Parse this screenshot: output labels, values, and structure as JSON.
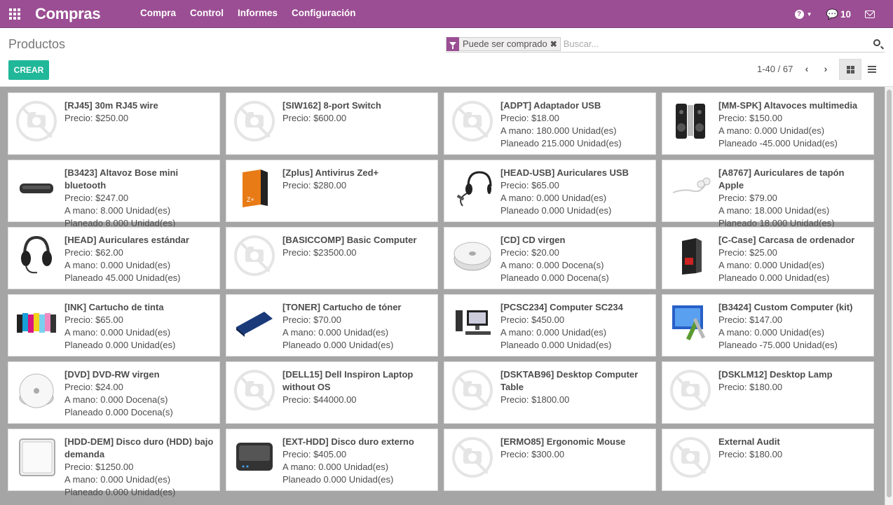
{
  "app": {
    "title": "Compras"
  },
  "menu": [
    "Compra",
    "Control",
    "Informes",
    "Configuración"
  ],
  "navbar": {
    "help_icon": "?",
    "messages_count": "10"
  },
  "control": {
    "page_title": "Productos",
    "create_label": "CREAR",
    "search_facet": "Puede ser comprado",
    "search_placeholder": "Buscar...",
    "pager": "1-40 / 67"
  },
  "products": [
    {
      "title": "[RJ45] 30m RJ45 wire",
      "lines": [
        "Precio: $250.00"
      ],
      "icon": "placeholder-icon"
    },
    {
      "title": "[SIW162] 8-port Switch",
      "lines": [
        "Precio: $600.00"
      ],
      "icon": "placeholder-icon"
    },
    {
      "title": "[ADPT] Adaptador USB",
      "lines": [
        "Precio: $18.00",
        "A mano: 180.000 Unidad(es)",
        "Planeado 215.000 Unidad(es)"
      ],
      "icon": "placeholder-icon"
    },
    {
      "title": "[MM-SPK] Altavoces multimedia",
      "lines": [
        "Precio: $150.00",
        "A mano: 0.000 Unidad(es)",
        "Planeado -45.000 Unidad(es)"
      ],
      "icon": "speakers-icon"
    },
    {
      "title": "[B3423] Altavoz Bose mini bluetooth",
      "lines": [
        "Precio: $247.00",
        "A mano: 8.000 Unidad(es)",
        "Planeado 8.000 Unidad(es)"
      ],
      "icon": "bluetooth-speaker-icon"
    },
    {
      "title": "[Zplus] Antivirus Zed+",
      "lines": [
        "Precio: $280.00"
      ],
      "icon": "software-box-icon"
    },
    {
      "title": "[HEAD-USB] Auriculares USB",
      "lines": [
        "Precio: $65.00",
        "A mano: 0.000 Unidad(es)",
        "Planeado 0.000 Unidad(es)"
      ],
      "icon": "headset-usb-icon"
    },
    {
      "title": "[A8767] Auriculares de tapón Apple",
      "lines": [
        "Precio: $79.00",
        "A mano: 18.000 Unidad(es)",
        "Planeado 18.000 Unidad(es)"
      ],
      "icon": "earphones-icon"
    },
    {
      "title": "[HEAD] Auriculares estándar",
      "lines": [
        "Precio: $62.00",
        "A mano: 0.000 Unidad(es)",
        "Planeado 45.000 Unidad(es)"
      ],
      "icon": "headset-icon"
    },
    {
      "title": "[BASICCOMP] Basic Computer",
      "lines": [
        "Precio: $23500.00"
      ],
      "icon": "placeholder-icon"
    },
    {
      "title": "[CD] CD virgen",
      "lines": [
        "Precio: $20.00",
        "A mano: 0.000 Docena(s)",
        "Planeado 0.000 Docena(s)"
      ],
      "icon": "cd-icon"
    },
    {
      "title": "[C-Case] Carcasa de ordenador",
      "lines": [
        "Precio: $25.00",
        "A mano: 0.000 Unidad(es)",
        "Planeado 0.000 Unidad(es)"
      ],
      "icon": "pc-case-icon"
    },
    {
      "title": "[INK] Cartucho de tinta",
      "lines": [
        "Precio: $65.00",
        "A mano: 0.000 Unidad(es)",
        "Planeado 0.000 Unidad(es)"
      ],
      "icon": "ink-cartridge-icon"
    },
    {
      "title": "[TONER] Cartucho de tóner",
      "lines": [
        "Precio: $70.00",
        "A mano: 0.000 Unidad(es)",
        "Planeado 0.000 Unidad(es)"
      ],
      "icon": "toner-icon"
    },
    {
      "title": "[PCSC234] Computer SC234",
      "lines": [
        "Precio: $450.00",
        "A mano: 0.000 Unidad(es)",
        "Planeado 0.000 Unidad(es)"
      ],
      "icon": "desktop-computer-icon"
    },
    {
      "title": "[B3424] Custom Computer (kit)",
      "lines": [
        "Precio: $147.00",
        "A mano: 0.000 Unidad(es)",
        "Planeado -75.000 Unidad(es)"
      ],
      "icon": "computer-kit-icon"
    },
    {
      "title": "[DVD] DVD-RW virgen",
      "lines": [
        "Precio: $24.00",
        "A mano: 0.000 Docena(s)",
        "Planeado 0.000 Docena(s)"
      ],
      "icon": "dvd-icon"
    },
    {
      "title": "[DELL15] Dell Inspiron Laptop without OS",
      "lines": [
        "Precio: $44000.00"
      ],
      "icon": "placeholder-icon"
    },
    {
      "title": "[DSKTAB96] Desktop Computer Table",
      "lines": [
        "Precio: $1800.00"
      ],
      "icon": "placeholder-icon"
    },
    {
      "title": "[DSKLM12] Desktop Lamp",
      "lines": [
        "Precio: $180.00"
      ],
      "icon": "placeholder-icon"
    },
    {
      "title": "[HDD-DEM] Disco duro (HDD) bajo demanda",
      "lines": [
        "Precio: $1250.00",
        "A mano: 0.000 Unidad(es)",
        "Planeado 0.000 Unidad(es)"
      ],
      "icon": "hard-drive-icon"
    },
    {
      "title": "[EXT-HDD] Disco duro externo",
      "lines": [
        "Precio: $405.00",
        "A mano: 0.000 Unidad(es)",
        "Planeado 0.000 Unidad(es)"
      ],
      "icon": "external-drive-icon"
    },
    {
      "title": "[ERMO85] Ergonomic Mouse",
      "lines": [
        "Precio: $300.00"
      ],
      "icon": "placeholder-icon"
    },
    {
      "title": "External Audit",
      "lines": [
        "Precio: $180.00"
      ],
      "icon": "placeholder-icon"
    }
  ]
}
